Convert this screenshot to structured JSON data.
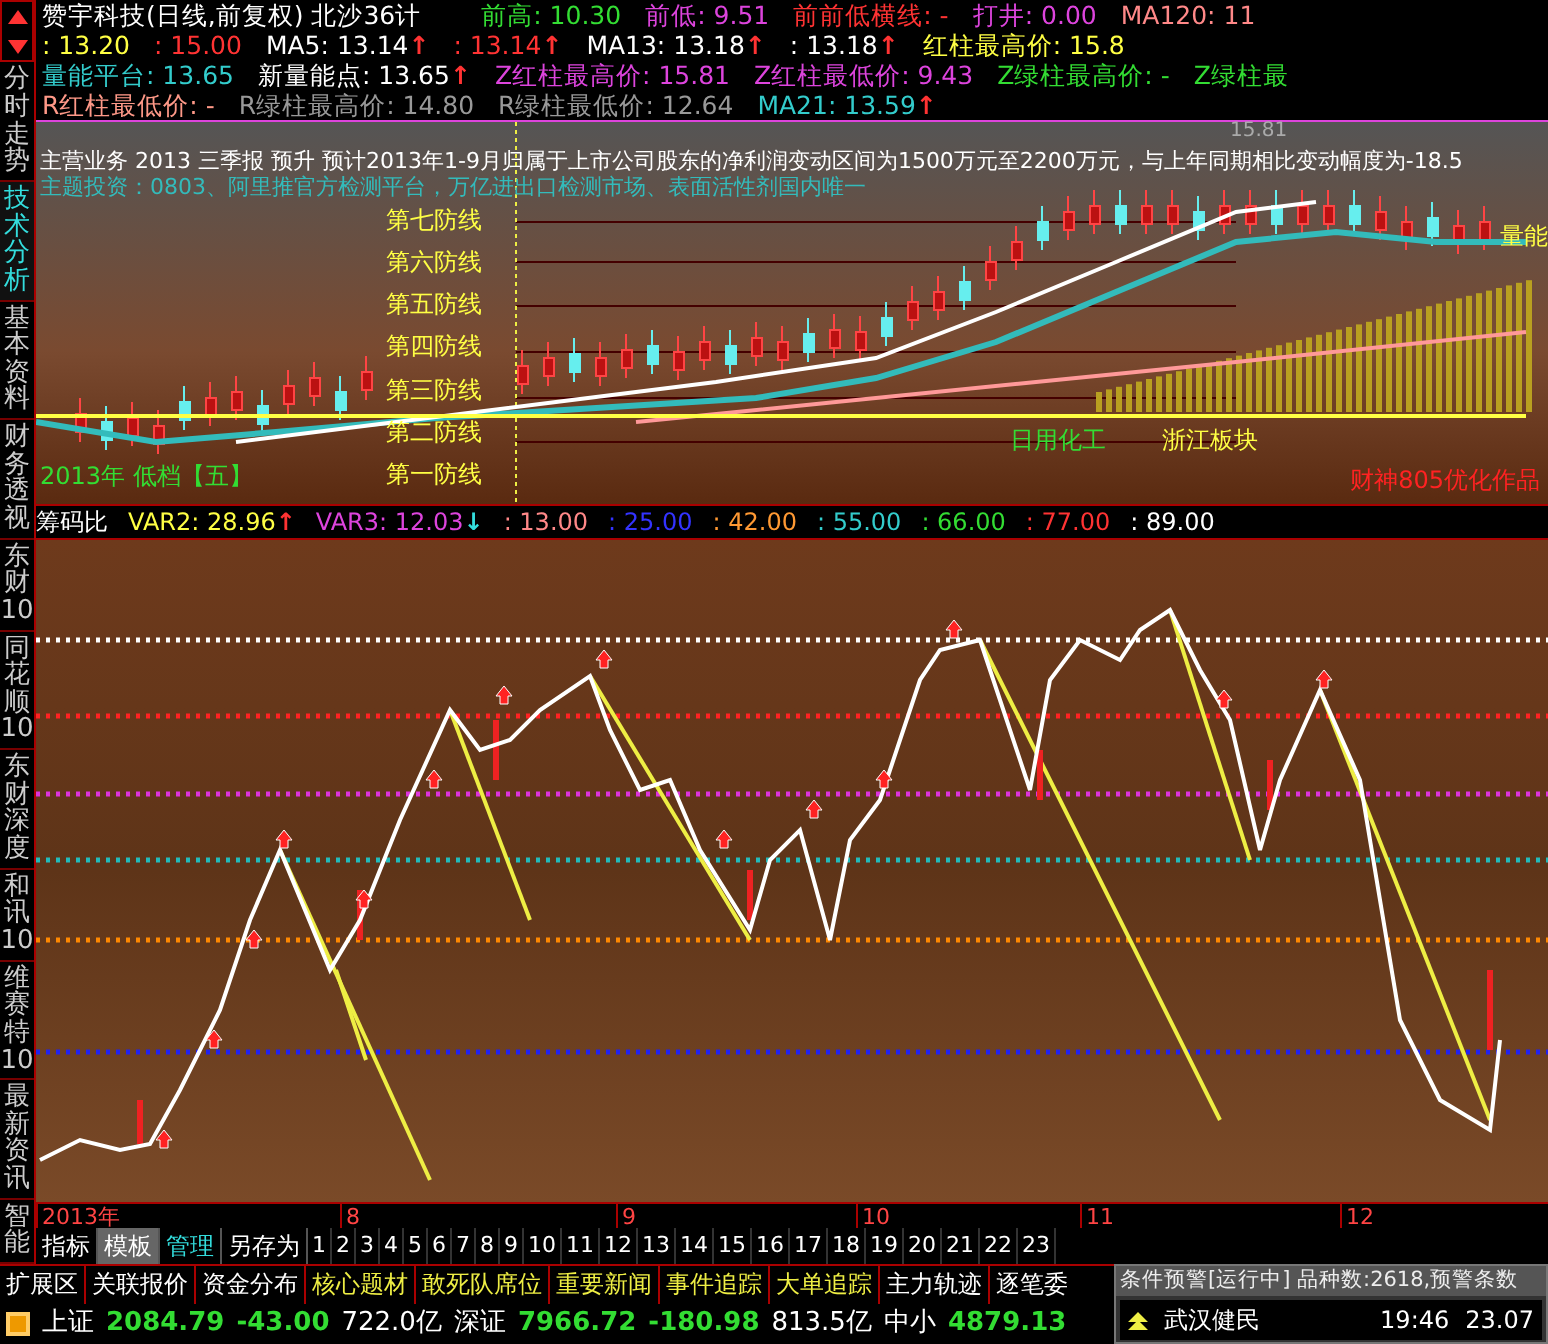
{
  "sidebar_tabs": [
    {
      "label": "分时走势",
      "selected": false
    },
    {
      "label": "技术分析",
      "selected": true
    },
    {
      "label": "基本资料",
      "selected": false
    },
    {
      "label": "财务透视",
      "selected": false
    },
    {
      "label": "东财10",
      "selected": false
    },
    {
      "label": "同花顺10",
      "selected": false
    },
    {
      "label": "东财深度",
      "selected": false
    },
    {
      "label": "和讯10",
      "selected": false
    },
    {
      "label": "维赛特10",
      "selected": false
    },
    {
      "label": "最新资讯",
      "selected": false
    },
    {
      "label": "智能",
      "selected": false
    }
  ],
  "header": {
    "title": "赞宇科技(日线,前复权) 北沙36计",
    "lines": [
      [
        {
          "text": "前高: 10.30",
          "color": "#33dd33"
        },
        {
          "text": "前低: 9.51",
          "color": "#dd44dd"
        },
        {
          "text": "前前低横线: -",
          "color": "#ff3333"
        },
        {
          "text": "打井: 0.00",
          "color": "#dd44dd"
        },
        {
          "text": "MA120: 11",
          "color": "#ff8888"
        }
      ],
      [
        {
          "text": ": 13.20",
          "color": "#ffff44"
        },
        {
          "text": ": 15.00",
          "color": "#ff3333"
        },
        {
          "text": "MA5: 13.14",
          "color": "#ffffff",
          "arrow": {
            "text": "↑",
            "color": "#ff3333"
          }
        },
        {
          "text": ": 13.14",
          "color": "#ff3333",
          "arrow": {
            "text": "↑",
            "color": "#ff3333"
          }
        },
        {
          "text": "MA13: 13.18",
          "color": "#ffffff",
          "arrow": {
            "text": "↑",
            "color": "#ff3333"
          }
        },
        {
          "text": ": 13.18",
          "color": "#ffffff",
          "arrow": {
            "text": "↑",
            "color": "#ff3333"
          }
        },
        {
          "text": "红柱最高价: 15.8",
          "color": "#ffff44"
        }
      ],
      [
        {
          "text": "量能平台: 13.65",
          "color": "#33cccc"
        },
        {
          "text": "新量能点: 13.65",
          "color": "#ffffff",
          "arrow": {
            "text": "↑",
            "color": "#ff3333"
          }
        },
        {
          "text": "Z红柱最高价: 15.81",
          "color": "#dd44dd"
        },
        {
          "text": "Z红柱最低价: 9.43",
          "color": "#dd44dd"
        },
        {
          "text": "Z绿柱最高价: -",
          "color": "#33dd33"
        },
        {
          "text": "Z绿柱最",
          "color": "#33dd33"
        }
      ],
      [
        {
          "text": "R红柱最低价: -",
          "color": "#ff9988"
        },
        {
          "text": "R绿柱最高价: 14.80",
          "color": "#999999"
        },
        {
          "text": "R绿柱最低价: 12.64",
          "color": "#999999"
        },
        {
          "text": "MA21: 13.59",
          "color": "#33cccc",
          "arrow": {
            "text": "↑",
            "color": "#ff3333"
          }
        }
      ]
    ]
  },
  "price_chart": {
    "business": "主营业务 2013 三季报 预升 预计2013年1-9月归属于上市公司股东的净利润变动区间为1500万元至2200万元，与上年同期相比变动幅度为-18.5",
    "theme": "主题投资：0803、阿里推官方检测平台，万亿进出口检测市场、表面活性剂国内唯一",
    "defense_lines": [
      "第七防线",
      "第六防线",
      "第五防线",
      "第四防线",
      "第三防线",
      "第二防线",
      "第一防线"
    ],
    "high_price": "15.81",
    "volume_tag": "量能",
    "stage": "2013年 低档【五】",
    "sectors": [
      "日用化工",
      "浙江板块"
    ],
    "credit": "财神805优化作品"
  },
  "indicator": {
    "name": "筹码比",
    "values": [
      {
        "text": "VAR2: 28.96",
        "color": "#ffff44",
        "arrow": {
          "text": "↑",
          "color": "#ff3333"
        }
      },
      {
        "text": "VAR3: 12.03",
        "color": "#dd44dd",
        "arrow": {
          "text": "↓",
          "color": "#33dddd"
        }
      },
      {
        "text": ": 13.00",
        "color": "#ff8888"
      },
      {
        "text": ": 25.00",
        "color": "#3333ff"
      },
      {
        "text": ": 42.00",
        "color": "#ff9933"
      },
      {
        "text": ": 55.00",
        "color": "#33cccc"
      },
      {
        "text": ": 66.00",
        "color": "#33dd33"
      },
      {
        "text": ": 77.00",
        "color": "#ff3333"
      },
      {
        "text": ": 89.00",
        "color": "#ffffff"
      }
    ]
  },
  "time_axis": [
    "2013年",
    "8",
    "9",
    "10",
    "11",
    "12"
  ],
  "template_bar": {
    "items": [
      {
        "label": "指标",
        "kind": "tab",
        "selected": false
      },
      {
        "label": "模板",
        "kind": "tab",
        "selected": true
      },
      {
        "label": "管理",
        "kind": "action",
        "selected": false
      },
      {
        "label": "另存为",
        "kind": "tab",
        "selected": false
      }
    ],
    "pages": [
      "1",
      "2",
      "3",
      "4",
      "5",
      "6",
      "7",
      "8",
      "9",
      "10",
      "11",
      "12",
      "13",
      "14",
      "15",
      "16",
      "17",
      "18",
      "19",
      "20",
      "21",
      "22",
      "23"
    ]
  },
  "extension_tabs": [
    {
      "label": "扩展区",
      "highlighted": false
    },
    {
      "label": "关联报价",
      "highlighted": false
    },
    {
      "label": "资金分布",
      "highlighted": false
    },
    {
      "label": "核心题材",
      "highlighted": true
    },
    {
      "label": "敢死队席位",
      "highlighted": true
    },
    {
      "label": "重要新闻",
      "highlighted": true
    },
    {
      "label": "事件追踪",
      "highlighted": true
    },
    {
      "label": "大单追踪",
      "highlighted": true
    },
    {
      "label": "主力轨迹",
      "highlighted": false
    },
    {
      "label": "逐笔委",
      "highlighted": false
    }
  ],
  "status_bar": [
    {
      "text": "上证",
      "kind": "name"
    },
    {
      "text": "2084.79",
      "kind": "value"
    },
    {
      "text": "-43.00",
      "kind": "value"
    },
    {
      "text": "722.0亿",
      "kind": "amount"
    },
    {
      "text": "深证",
      "kind": "name"
    },
    {
      "text": "7966.72",
      "kind": "value"
    },
    {
      "text": "-180.98",
      "kind": "value"
    },
    {
      "text": "813.5亿",
      "kind": "amount"
    },
    {
      "text": "中小",
      "kind": "name"
    },
    {
      "text": "4879.13",
      "kind": "value"
    }
  ],
  "alert_popup": {
    "title": "条件预警[运行中] 品种数:2618,预警条数",
    "rows": [
      {
        "name": "武汉健民",
        "time": "19:46",
        "price": "23.07"
      }
    ]
  }
}
